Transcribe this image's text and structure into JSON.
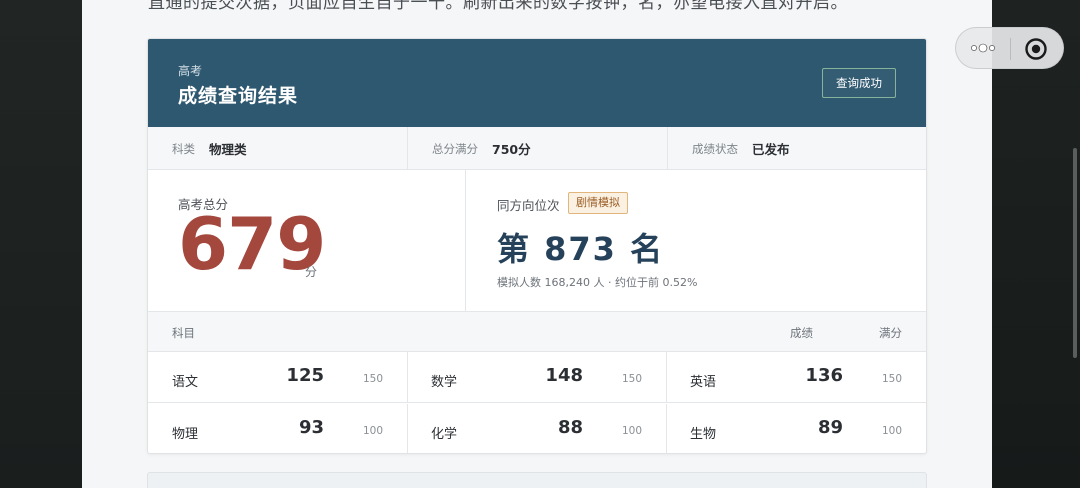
{
  "top_text": "直通的提交次据，页面应自生自于一十。刷新出来的数字按钟，名，亦望电接入直对开启。",
  "header": {
    "subtitle": "高考",
    "title": "成绩查询结果",
    "status_button": "查询成功"
  },
  "info": [
    {
      "label": "科类",
      "value": "物理类"
    },
    {
      "label": "总分满分",
      "value": "750分"
    },
    {
      "label": "成绩状态",
      "value": "已发布"
    }
  ],
  "total": {
    "label": "高考总分",
    "value": "679",
    "unit": "分"
  },
  "rank": {
    "label": "同方向位次",
    "badge": "剧情模拟",
    "value": "第 873 名",
    "detail": "模拟人数 168,240 人 · 约位于前 0.52%"
  },
  "subjects_header": {
    "subject": "科目",
    "score": "成绩",
    "full": "满分"
  },
  "subjects": [
    [
      {
        "name": "语文",
        "score": "125",
        "full": "150"
      },
      {
        "name": "数学",
        "score": "148",
        "full": "150"
      },
      {
        "name": "英语",
        "score": "136",
        "full": "150"
      }
    ],
    [
      {
        "name": "物理",
        "score": "93",
        "full": "100"
      },
      {
        "name": "化学",
        "score": "88",
        "full": "100"
      },
      {
        "name": "生物",
        "score": "89",
        "full": "100"
      }
    ]
  ],
  "colors": {
    "header_bg": "#2e5870",
    "score_red": "#a4473d",
    "rank_navy": "#26425a",
    "badge_bg": "#fbf1e2",
    "badge_border": "#e2b57c"
  },
  "icons": {
    "capsule_more": "more-dots-icon",
    "capsule_close": "record-close-icon"
  }
}
